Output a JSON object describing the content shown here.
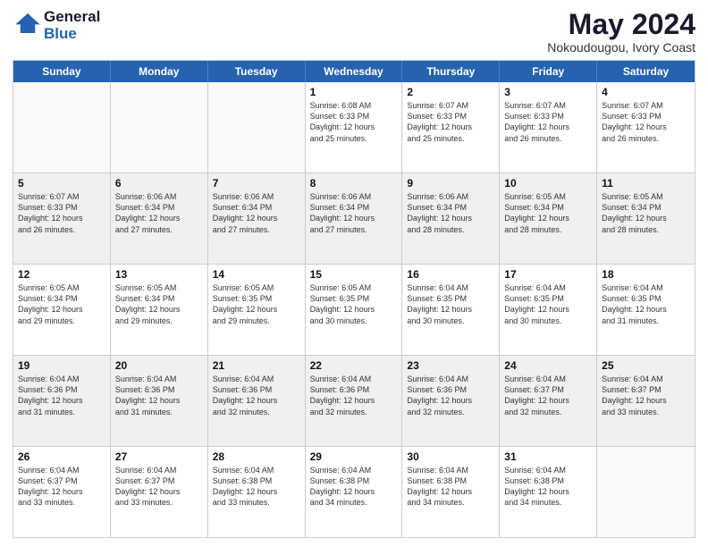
{
  "header": {
    "logo_line1": "General",
    "logo_line2": "Blue",
    "main_title": "May 2024",
    "subtitle": "Nokoudougou, Ivory Coast"
  },
  "days_of_week": [
    "Sunday",
    "Monday",
    "Tuesday",
    "Wednesday",
    "Thursday",
    "Friday",
    "Saturday"
  ],
  "weeks": [
    [
      {
        "day": "",
        "text": ""
      },
      {
        "day": "",
        "text": ""
      },
      {
        "day": "",
        "text": ""
      },
      {
        "day": "1",
        "text": "Sunrise: 6:08 AM\nSunset: 6:33 PM\nDaylight: 12 hours\nand 25 minutes."
      },
      {
        "day": "2",
        "text": "Sunrise: 6:07 AM\nSunset: 6:33 PM\nDaylight: 12 hours\nand 25 minutes."
      },
      {
        "day": "3",
        "text": "Sunrise: 6:07 AM\nSunset: 6:33 PM\nDaylight: 12 hours\nand 26 minutes."
      },
      {
        "day": "4",
        "text": "Sunrise: 6:07 AM\nSunset: 6:33 PM\nDaylight: 12 hours\nand 26 minutes."
      }
    ],
    [
      {
        "day": "5",
        "text": "Sunrise: 6:07 AM\nSunset: 6:33 PM\nDaylight: 12 hours\nand 26 minutes."
      },
      {
        "day": "6",
        "text": "Sunrise: 6:06 AM\nSunset: 6:34 PM\nDaylight: 12 hours\nand 27 minutes."
      },
      {
        "day": "7",
        "text": "Sunrise: 6:06 AM\nSunset: 6:34 PM\nDaylight: 12 hours\nand 27 minutes."
      },
      {
        "day": "8",
        "text": "Sunrise: 6:06 AM\nSunset: 6:34 PM\nDaylight: 12 hours\nand 27 minutes."
      },
      {
        "day": "9",
        "text": "Sunrise: 6:06 AM\nSunset: 6:34 PM\nDaylight: 12 hours\nand 28 minutes."
      },
      {
        "day": "10",
        "text": "Sunrise: 6:05 AM\nSunset: 6:34 PM\nDaylight: 12 hours\nand 28 minutes."
      },
      {
        "day": "11",
        "text": "Sunrise: 6:05 AM\nSunset: 6:34 PM\nDaylight: 12 hours\nand 28 minutes."
      }
    ],
    [
      {
        "day": "12",
        "text": "Sunrise: 6:05 AM\nSunset: 6:34 PM\nDaylight: 12 hours\nand 29 minutes."
      },
      {
        "day": "13",
        "text": "Sunrise: 6:05 AM\nSunset: 6:34 PM\nDaylight: 12 hours\nand 29 minutes."
      },
      {
        "day": "14",
        "text": "Sunrise: 6:05 AM\nSunset: 6:35 PM\nDaylight: 12 hours\nand 29 minutes."
      },
      {
        "day": "15",
        "text": "Sunrise: 6:05 AM\nSunset: 6:35 PM\nDaylight: 12 hours\nand 30 minutes."
      },
      {
        "day": "16",
        "text": "Sunrise: 6:04 AM\nSunset: 6:35 PM\nDaylight: 12 hours\nand 30 minutes."
      },
      {
        "day": "17",
        "text": "Sunrise: 6:04 AM\nSunset: 6:35 PM\nDaylight: 12 hours\nand 30 minutes."
      },
      {
        "day": "18",
        "text": "Sunrise: 6:04 AM\nSunset: 6:35 PM\nDaylight: 12 hours\nand 31 minutes."
      }
    ],
    [
      {
        "day": "19",
        "text": "Sunrise: 6:04 AM\nSunset: 6:36 PM\nDaylight: 12 hours\nand 31 minutes."
      },
      {
        "day": "20",
        "text": "Sunrise: 6:04 AM\nSunset: 6:36 PM\nDaylight: 12 hours\nand 31 minutes."
      },
      {
        "day": "21",
        "text": "Sunrise: 6:04 AM\nSunset: 6:36 PM\nDaylight: 12 hours\nand 32 minutes."
      },
      {
        "day": "22",
        "text": "Sunrise: 6:04 AM\nSunset: 6:36 PM\nDaylight: 12 hours\nand 32 minutes."
      },
      {
        "day": "23",
        "text": "Sunrise: 6:04 AM\nSunset: 6:36 PM\nDaylight: 12 hours\nand 32 minutes."
      },
      {
        "day": "24",
        "text": "Sunrise: 6:04 AM\nSunset: 6:37 PM\nDaylight: 12 hours\nand 32 minutes."
      },
      {
        "day": "25",
        "text": "Sunrise: 6:04 AM\nSunset: 6:37 PM\nDaylight: 12 hours\nand 33 minutes."
      }
    ],
    [
      {
        "day": "26",
        "text": "Sunrise: 6:04 AM\nSunset: 6:37 PM\nDaylight: 12 hours\nand 33 minutes."
      },
      {
        "day": "27",
        "text": "Sunrise: 6:04 AM\nSunset: 6:37 PM\nDaylight: 12 hours\nand 33 minutes."
      },
      {
        "day": "28",
        "text": "Sunrise: 6:04 AM\nSunset: 6:38 PM\nDaylight: 12 hours\nand 33 minutes."
      },
      {
        "day": "29",
        "text": "Sunrise: 6:04 AM\nSunset: 6:38 PM\nDaylight: 12 hours\nand 34 minutes."
      },
      {
        "day": "30",
        "text": "Sunrise: 6:04 AM\nSunset: 6:38 PM\nDaylight: 12 hours\nand 34 minutes."
      },
      {
        "day": "31",
        "text": "Sunrise: 6:04 AM\nSunset: 6:38 PM\nDaylight: 12 hours\nand 34 minutes."
      },
      {
        "day": "",
        "text": ""
      }
    ]
  ]
}
